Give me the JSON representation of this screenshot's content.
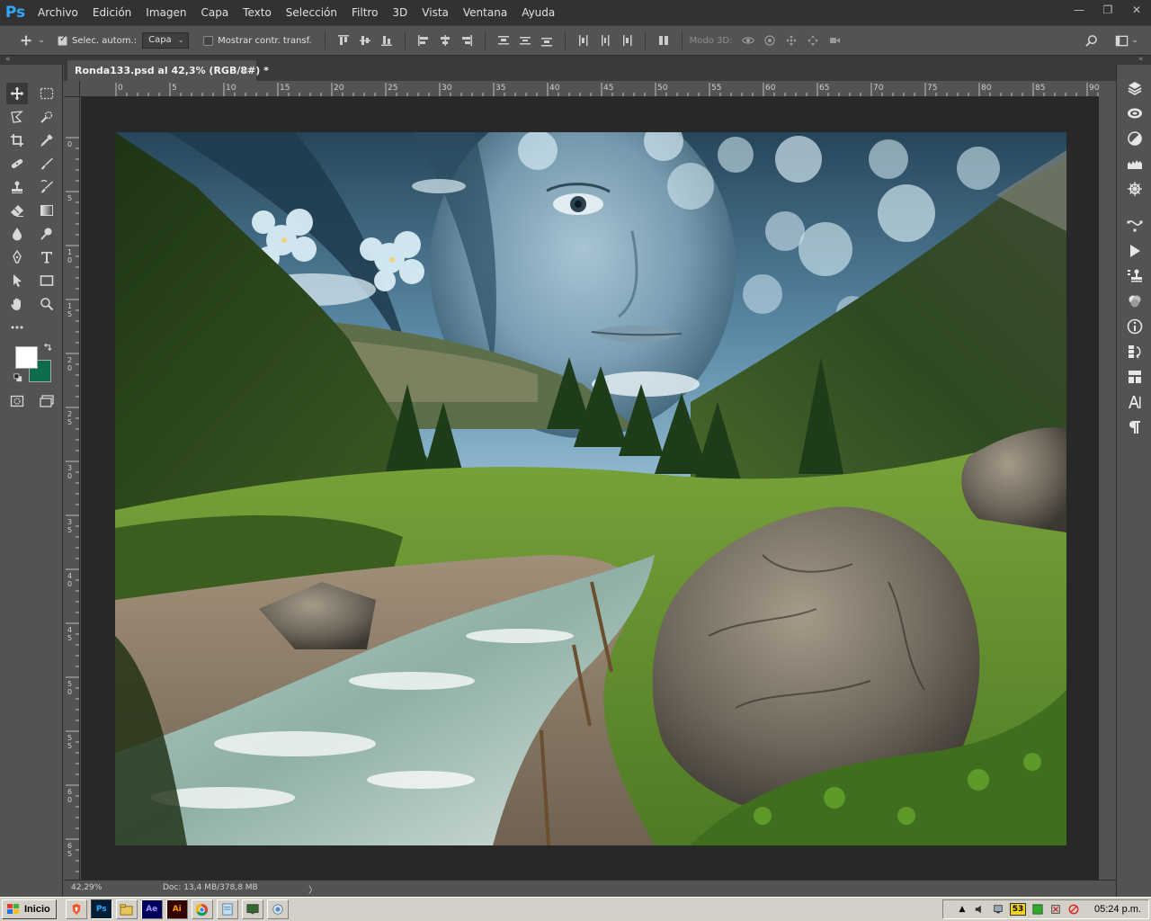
{
  "app": {
    "logo": "Ps",
    "menu": [
      "Archivo",
      "Edición",
      "Imagen",
      "Capa",
      "Texto",
      "Selección",
      "Filtro",
      "3D",
      "Vista",
      "Ventana",
      "Ayuda"
    ]
  },
  "window_controls": {
    "minimize": "—",
    "restore": "❐",
    "close": "✕"
  },
  "options": {
    "auto_select_label": "Selec. autom.:",
    "auto_select_checked": true,
    "layer_select_value": "Capa",
    "show_transform_label": "Mostrar contr. transf.",
    "show_transform_checked": false,
    "mode3d_label": "Modo 3D:"
  },
  "document": {
    "tab_title": "Ronda133.psd al 42,3% (RGB/8#) *",
    "close_glyph": "×"
  },
  "ruler_top_labels": [
    "0",
    "5",
    "10",
    "15",
    "20",
    "25",
    "30",
    "35",
    "40",
    "45",
    "50",
    "55",
    "60",
    "65",
    "70",
    "75",
    "80",
    "85",
    "90"
  ],
  "ruler_left_labels": [
    "0",
    "5",
    "1 0",
    "1 5",
    "2 0",
    "2 5",
    "3 0",
    "3 5",
    "4 0",
    "4 5",
    "5 0",
    "5 5",
    "6 0",
    "6 5"
  ],
  "status": {
    "zoom": "42,29%",
    "doc_size": "Doc: 13,4 MB/378,8 MB",
    "arrow": "〉"
  },
  "colors": {
    "foreground": "#ffffff",
    "background": "#0e6b4e",
    "ps_blue": "#31a8ff"
  },
  "taskbar": {
    "start_label": "Inicio",
    "clock": "05:24 p.m.",
    "apps": [
      {
        "name": "brave",
        "glyph": "🦁"
      },
      {
        "name": "photoshop",
        "glyph": "Ps"
      },
      {
        "name": "explorer",
        "glyph": "📁"
      },
      {
        "name": "after-effects",
        "glyph": "Ae"
      },
      {
        "name": "illustrator",
        "glyph": "Ai"
      },
      {
        "name": "chrome",
        "glyph": "◉"
      },
      {
        "name": "notepad",
        "glyph": "▤"
      },
      {
        "name": "monitor",
        "glyph": "▣"
      },
      {
        "name": "network-tool",
        "glyph": "◎"
      }
    ],
    "tray_badge": "53"
  }
}
